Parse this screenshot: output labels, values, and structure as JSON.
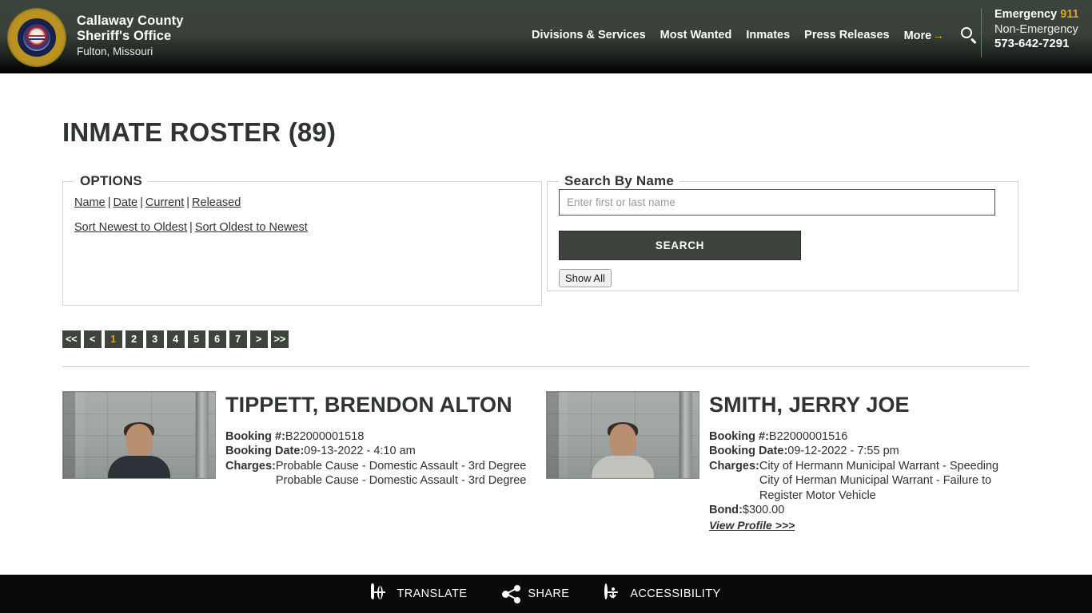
{
  "header": {
    "brand": {
      "line1": "Callaway County",
      "line2": "Sheriff's Office",
      "line3": "Fulton, Missouri",
      "logo_icon": "sheriff-badge-seal-icon"
    },
    "nav": [
      {
        "label": "Divisions & Services"
      },
      {
        "label": "Most Wanted"
      },
      {
        "label": "Inmates"
      },
      {
        "label": "Press Releases"
      },
      {
        "label": "More"
      }
    ],
    "more_arrow": "→",
    "search_icon": "search-icon",
    "emergency": {
      "label": "Emergency",
      "number": "911",
      "non_emergency_label": "Non-Emergency",
      "non_emergency_number": "573-642-7291"
    },
    "accent_color": "#d9a520",
    "background_color": "#3b443c"
  },
  "main": {
    "page_title": "INMATE ROSTER (89)",
    "options": {
      "legend": "OPTIONS",
      "filters": [
        {
          "label": "Name"
        },
        {
          "label": "Date"
        },
        {
          "label": "Current"
        },
        {
          "label": "Released"
        }
      ],
      "sorts": [
        {
          "label": "Sort Newest to Oldest"
        },
        {
          "label": "Sort Oldest to Newest"
        }
      ],
      "separator": "|"
    },
    "search": {
      "legend": "Search By Name",
      "placeholder": "Enter first or last name",
      "value": "",
      "search_button": "SEARCH",
      "show_all_button": "Show All"
    },
    "pagination": {
      "first": "<<",
      "prev": "<",
      "pages": [
        "1",
        "2",
        "3",
        "4",
        "5",
        "6",
        "7"
      ],
      "active_page": "1",
      "next": ">",
      "last": ">>"
    },
    "labels": {
      "booking_number": "Booking #:",
      "booking_date": "Booking Date:",
      "charges": "Charges:",
      "bond": "Bond:",
      "view_profile": "View Profile >>>"
    },
    "inmates": [
      {
        "name": "TIPPETT, BRENDON ALTON",
        "booking_number": "B22000001518",
        "booking_date": "09-13-2022 - 4:10 am",
        "charges": [
          "Probable Cause - Domestic Assault - 3rd Degree",
          "Probable Cause - Domestic Assault - 3rd Degree"
        ],
        "bond": "",
        "photo_alt": "inmate-mugshot"
      },
      {
        "name": "SMITH, JERRY JOE",
        "booking_number": "B22000001516",
        "booking_date": "09-12-2022 - 7:55 pm",
        "charges": [
          "City of Hermann Municipal Warrant - Speeding",
          "City of Herman Municipal Warrant - Failure to Register Motor Vehicle"
        ],
        "bond": "$300.00",
        "photo_alt": "inmate-mugshot"
      }
    ]
  },
  "footer": {
    "items": [
      {
        "label": "TRANSLATE",
        "icon": "globe-icon"
      },
      {
        "label": "SHARE",
        "icon": "share-icon"
      },
      {
        "label": "ACCESSIBILITY",
        "icon": "accessibility-icon"
      }
    ],
    "background_color": "#0a0a0a"
  }
}
